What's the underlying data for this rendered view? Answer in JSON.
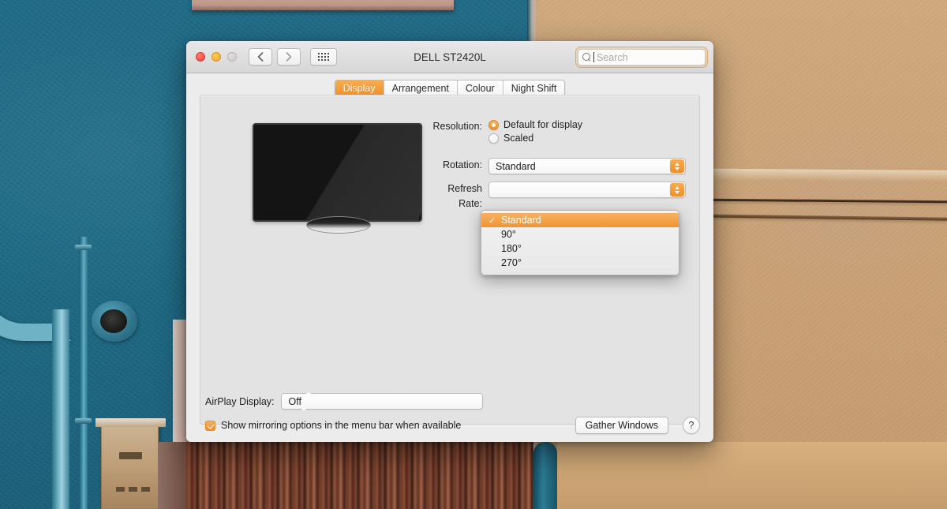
{
  "window": {
    "title": "DELL ST2420L",
    "traffic_lights": [
      "close",
      "minimize",
      "zoom"
    ],
    "nav": {
      "back": "‹",
      "forward": "›",
      "show_all": "show-all-grid"
    },
    "search": {
      "placeholder": "Search",
      "value": ""
    }
  },
  "tabs": [
    {
      "label": "Display",
      "active": true
    },
    {
      "label": "Arrangement",
      "active": false
    },
    {
      "label": "Colour",
      "active": false
    },
    {
      "label": "Night Shift",
      "active": false
    }
  ],
  "display": {
    "resolution_label": "Resolution:",
    "resolution_options": [
      {
        "label": "Default for display",
        "selected": true
      },
      {
        "label": "Scaled",
        "selected": false
      }
    ],
    "rotation_label": "Rotation:",
    "rotation_value": "Standard",
    "refresh_label": "Refresh Rate:",
    "refresh_value": ""
  },
  "rotation_menu": {
    "open": true,
    "items": [
      {
        "label": "Standard",
        "selected": true
      },
      {
        "label": "90°",
        "selected": false
      },
      {
        "label": "180°",
        "selected": false
      },
      {
        "label": "270°",
        "selected": false
      }
    ]
  },
  "footer": {
    "airplay_label": "AirPlay Display:",
    "airplay_value": "Off",
    "mirroring_label": "Show mirroring options in the menu bar when available",
    "mirroring_checked": true,
    "gather_label": "Gather Windows",
    "help_label": "?"
  },
  "colors": {
    "accent_orange": "#f09433",
    "window_chrome": "#ececec",
    "panel": "#e3e3e3",
    "wall_teal": "#1d6480",
    "wall_tan": "#c9a175"
  }
}
